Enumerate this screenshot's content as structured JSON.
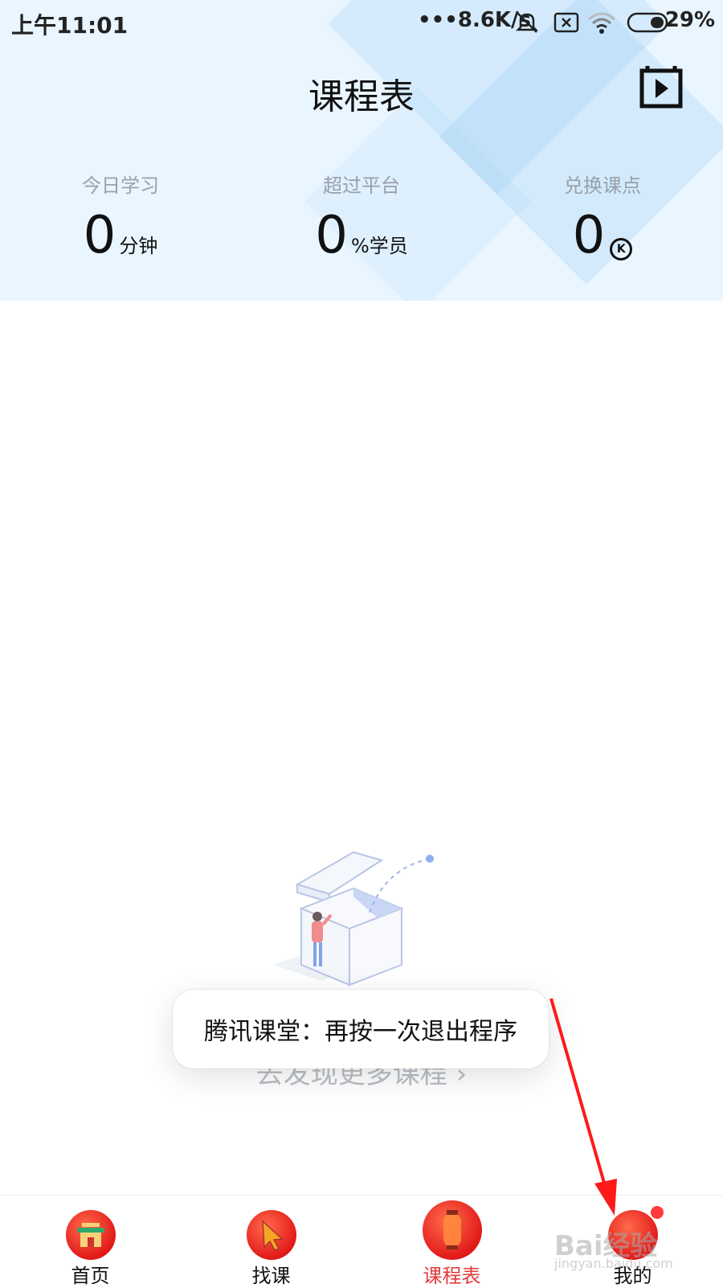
{
  "status_bar": {
    "time": "上午11:01",
    "net_speed": "•••8.6K/s",
    "battery": "29%"
  },
  "header": {
    "title": "课程表",
    "stats": [
      {
        "label": "今日学习",
        "value": "0",
        "unit": "分钟"
      },
      {
        "label": "超过平台",
        "value": "0",
        "unit": "%学员"
      },
      {
        "label": "兑换课点",
        "value": "0",
        "unit_icon": "k-coin-icon"
      }
    ]
  },
  "empty_state": {
    "discover_text": "去发现更多课程 ›"
  },
  "toast": {
    "text": "腾讯课堂：再按一次退出程序"
  },
  "bottom_nav": {
    "items": [
      {
        "label": "首页",
        "icon": "home-temple-icon"
      },
      {
        "label": "找课",
        "icon": "cursor-icon"
      },
      {
        "label": "课程表",
        "icon": "lantern-icon",
        "active": true
      },
      {
        "label": "我的",
        "icon": "profile-icon"
      }
    ]
  },
  "watermark": {
    "brand": "Bai经验",
    "url": "jingyan.baidu.com"
  },
  "colors": {
    "accent": "#e23b3b",
    "header_bg": "#e9f5ff",
    "annotation_arrow": "#ff1a1a"
  }
}
